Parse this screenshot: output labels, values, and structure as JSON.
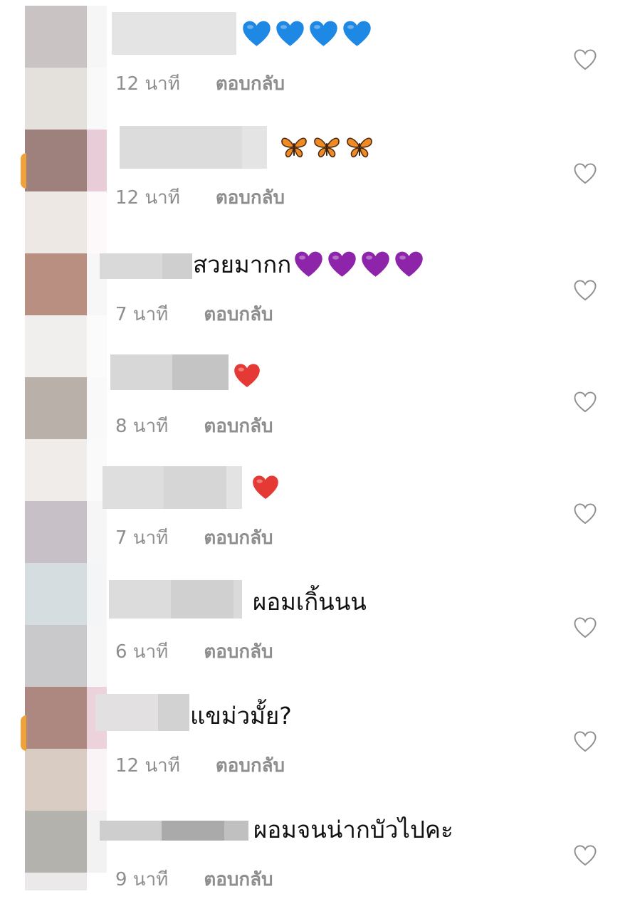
{
  "comments": [
    {
      "text": "",
      "emoji": "blue-heart",
      "emoji_count": 4,
      "time": "12 นาที",
      "reply": "ตอบกลับ"
    },
    {
      "text": "",
      "emoji": "butterfly",
      "emoji_count": 3,
      "time": "12 นาที",
      "reply": "ตอบกลับ"
    },
    {
      "text": "สวยมากก",
      "emoji": "purple-heart",
      "emoji_count": 4,
      "time": "7 นาที",
      "reply": "ตอบกลับ"
    },
    {
      "text": "",
      "emoji": "red-heart",
      "emoji_count": 1,
      "time": "8 นาที",
      "reply": "ตอบกลับ"
    },
    {
      "text": "",
      "emoji": "red-heart",
      "emoji_count": 1,
      "time": "7 นาที",
      "reply": "ตอบกลับ"
    },
    {
      "text": "ผอมเกิ้นนน",
      "emoji": "",
      "emoji_count": 0,
      "time": "6 นาที",
      "reply": "ตอบกลับ"
    },
    {
      "text": "แขม่วมั้ย?",
      "emoji": "",
      "emoji_count": 0,
      "time": "12 นาที",
      "reply": "ตอบกลับ"
    },
    {
      "text": "ผอมจนน่ากบัวไปคะ",
      "emoji": "",
      "emoji_count": 0,
      "time": "9 นาที",
      "reply": "ตอบกลับ"
    }
  ],
  "icons": {
    "like": "heart-outline-icon"
  },
  "colors": {
    "meta": "#8e8e8e",
    "blue_heart": "#1e88e5",
    "purple_heart": "#8e24aa",
    "red_heart": "#e53935",
    "butterfly": "#f08a24"
  }
}
